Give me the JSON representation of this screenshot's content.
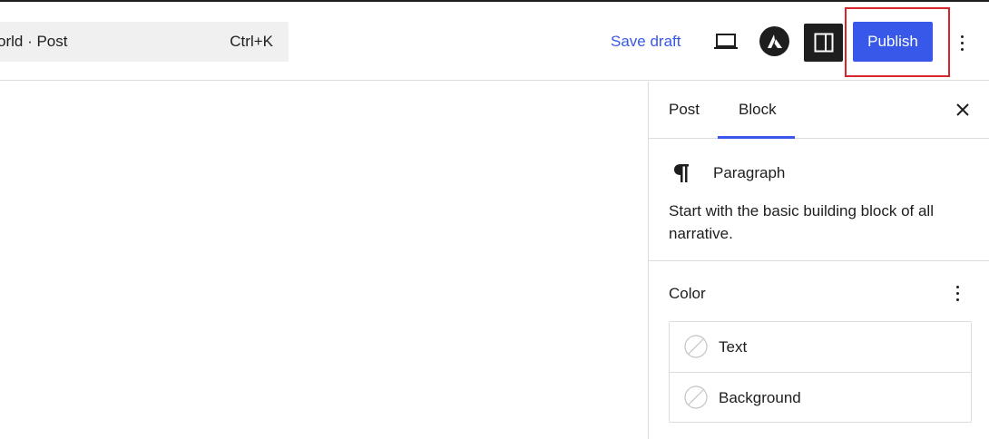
{
  "header": {
    "command_title": "orld · Post",
    "command_shortcut": "Ctrl+K",
    "save_draft_label": "Save draft",
    "publish_label": "Publish",
    "icons": {
      "preview": "laptop-icon",
      "astra": "astra-logo-icon",
      "settings": "sidebar-toggle-icon",
      "more": "vertical-ellipsis-icon"
    },
    "colors": {
      "accent": "#3858e9",
      "highlight": "#d7262b",
      "dark": "#1e1e1e"
    }
  },
  "sidebar": {
    "tabs": [
      {
        "label": "Post"
      },
      {
        "label": "Block"
      }
    ],
    "active_tab": "Block",
    "close_icon": "close-icon",
    "block": {
      "icon": "pilcrow-icon",
      "title": "Paragraph",
      "description": "Start with the basic building block of all narrative."
    },
    "color_panel": {
      "title": "Color",
      "options_icon": "vertical-ellipsis-icon",
      "items": [
        {
          "label": "Text"
        },
        {
          "label": "Background"
        }
      ]
    }
  }
}
